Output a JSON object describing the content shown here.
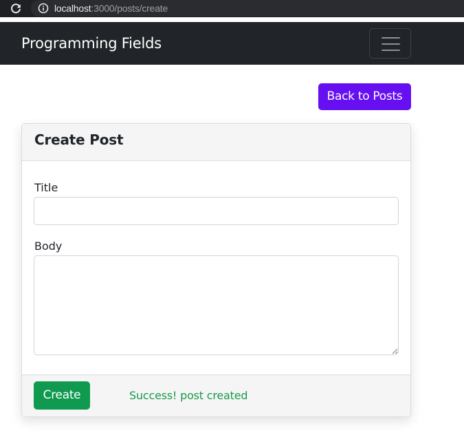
{
  "browser": {
    "url_host": "localhost",
    "url_path": ":3000/posts/create"
  },
  "navbar": {
    "brand": "Programming Fields",
    "toggler_icon": "hamburger-menu-icon"
  },
  "actions": {
    "back_label": "Back to Posts"
  },
  "card": {
    "title": "Create Post",
    "fields": {
      "title_label": "Title",
      "title_value": "",
      "body_label": "Body",
      "body_value": ""
    },
    "footer": {
      "create_label": "Create",
      "status_message": "Success! post created"
    }
  },
  "colors": {
    "navbar_bg": "#212529",
    "back_button": "#6610f2",
    "create_button": "#0f9a50",
    "success_text": "#1a9a4a"
  }
}
